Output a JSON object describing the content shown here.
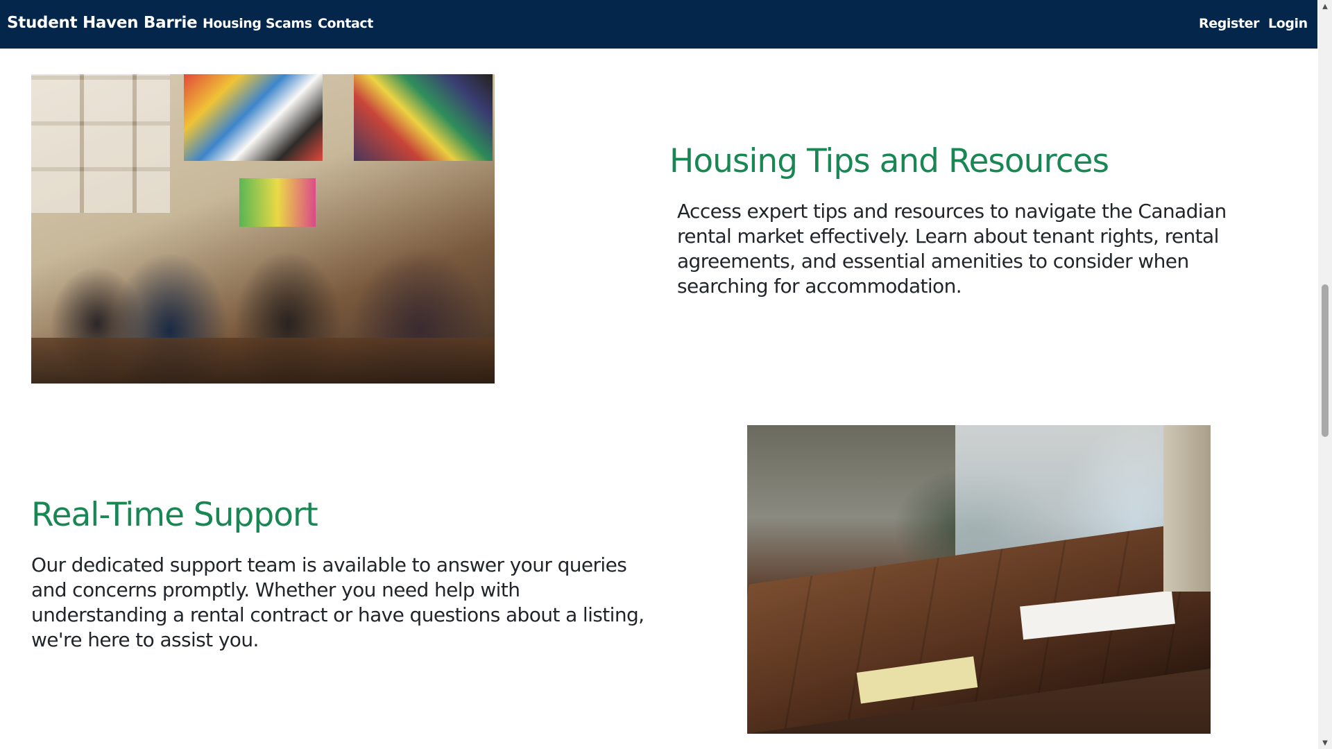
{
  "navbar": {
    "brand": "Student Haven Barrie",
    "links": [
      "Housing Scams",
      "Contact"
    ],
    "auth": [
      "Register",
      "Login"
    ]
  },
  "sections": [
    {
      "title": "Housing Tips and Resources",
      "body": "Access expert tips and resources to navigate the Canadian rental market effectively. Learn about tenant rights, rental agreements, and essential amenities to consider when searching for accommodation."
    },
    {
      "title": "Real-Time Support",
      "body": "Our dedicated support team is available to answer your queries and concerns promptly. Whether you need help with understanding a rental contract or have questions about a listing, we're here to assist you."
    }
  ],
  "colors": {
    "navbar_bg": "#03264a",
    "heading": "#198754",
    "text": "#212529"
  },
  "icons": {
    "scroll_up": "triangle-up-icon",
    "scroll_down": "triangle-down-icon"
  }
}
